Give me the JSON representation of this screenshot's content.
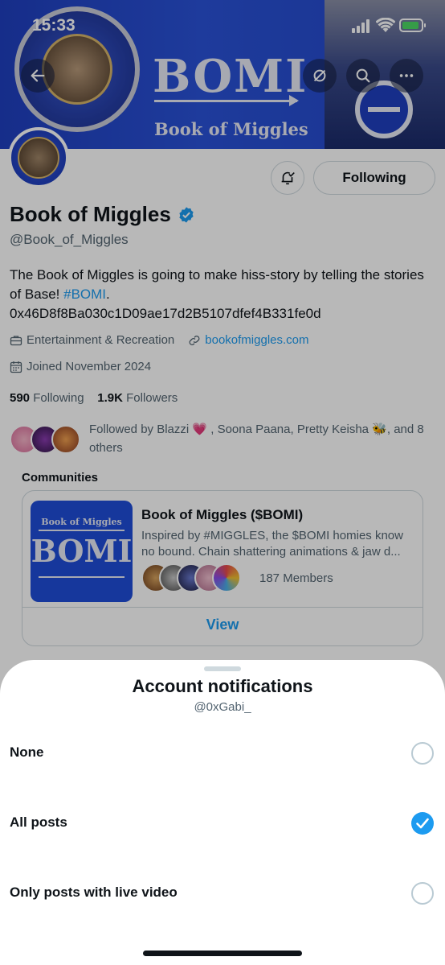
{
  "status_bar": {
    "time": "15:33"
  },
  "banner": {
    "title": "BOMI",
    "subtitle": "Book of Miggles"
  },
  "profile": {
    "name": "Book of Miggles",
    "handle": "@Book_of_Miggles",
    "bio_text": "The Book of Miggles is going to make hiss-story by telling the stories of Base! ",
    "bio_hashtag": "#BOMI",
    "bio_end": ".",
    "bio_address": "0x46D8f8Ba030c1D09ae17d2B5107dfef4B331fe0d",
    "category": "Entertainment & Recreation",
    "website": "bookofmiggles.com",
    "joined": "Joined November 2024",
    "following_count": "590",
    "following_label": "Following",
    "followers_count": "1.9K",
    "followers_label": "Followers",
    "followed_by": "Followed by Blazzi 💗 , Soona Paana, Pretty Keisha 🐝, and 8 others",
    "following_button": "Following"
  },
  "communities": {
    "title": "Communities",
    "card": {
      "image_text_small": "Book of Miggles",
      "image_text_big": "BOMI",
      "name": "Book of Miggles ($BOMI)",
      "description": "Inspired by #MIGGLES, the $BOMI homies know no bound. Chain shattering animations & jaw d...",
      "members": "187 Members",
      "view_label": "View"
    }
  },
  "sheet": {
    "title": "Account notifications",
    "subtitle": "@0xGabi_",
    "options": [
      {
        "label": "None",
        "selected": false
      },
      {
        "label": "All posts",
        "selected": true
      },
      {
        "label": "Only posts with live video",
        "selected": false
      }
    ]
  },
  "colors": {
    "accent": "#1d9bf0",
    "banner": "#2448c9",
    "text": "#0f1419",
    "muted": "#536471"
  },
  "icons": [
    "back-arrow-icon",
    "sync-icon",
    "search-icon",
    "more-icon",
    "bell-check-icon",
    "verified-badge-icon",
    "briefcase-icon",
    "link-icon",
    "calendar-icon",
    "check-icon"
  ]
}
